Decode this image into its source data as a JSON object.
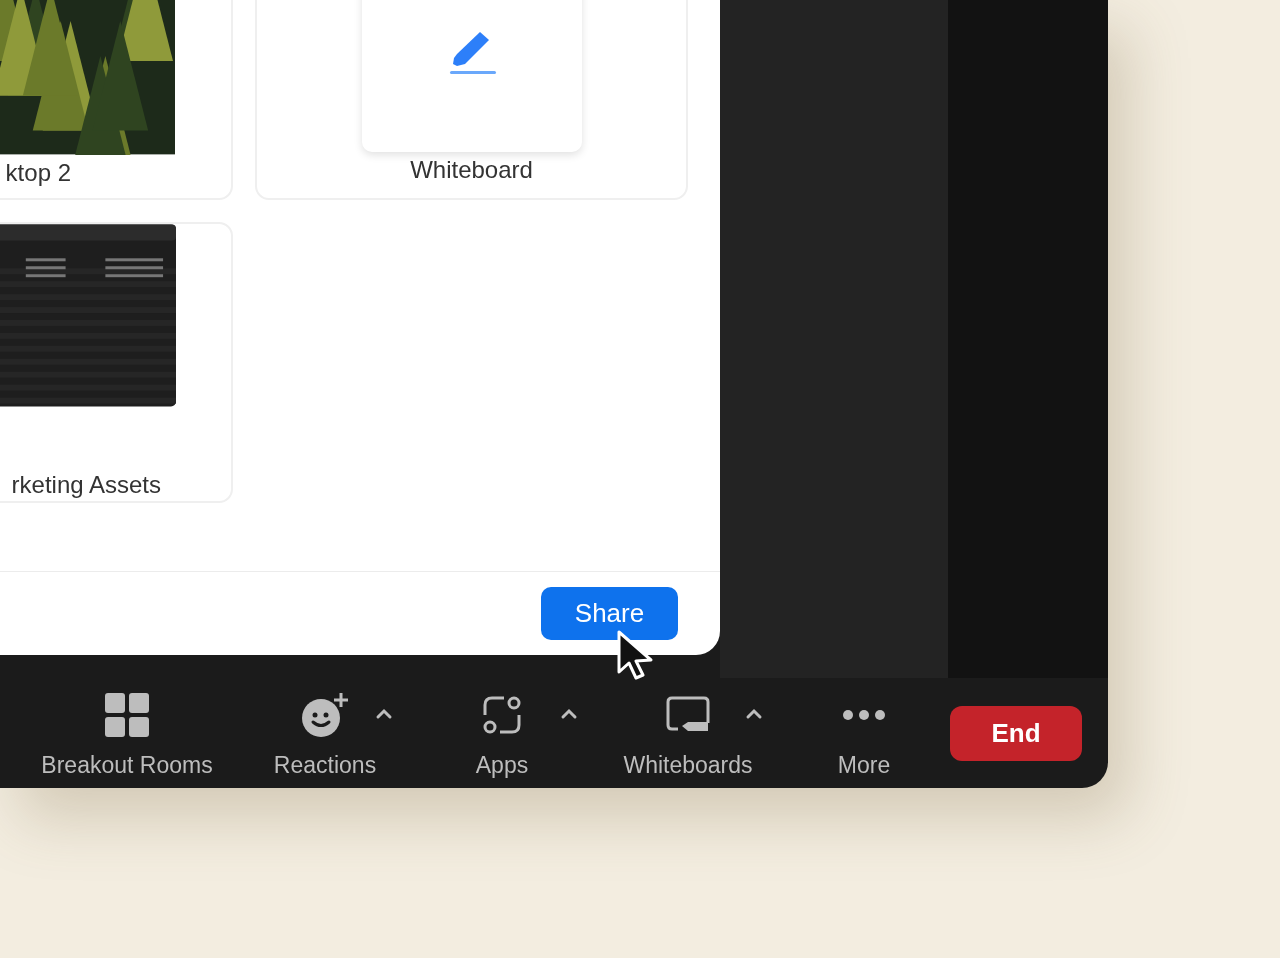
{
  "share_dialog": {
    "items": [
      {
        "label": "ktop 2",
        "kind": "picture",
        "selected": false
      },
      {
        "label": "Whiteboard",
        "kind": "whiteboard",
        "selected": false
      },
      {
        "label": "rketing Assets",
        "kind": "window",
        "selected": false
      }
    ],
    "share_button": "Share"
  },
  "toolbar": {
    "items": [
      {
        "label": "Breakout Rooms",
        "has_menu": false
      },
      {
        "label": "Reactions",
        "has_menu": true
      },
      {
        "label": "Apps",
        "has_menu": true
      },
      {
        "label": "Whiteboards",
        "has_menu": true
      },
      {
        "label": "More",
        "has_menu": false
      }
    ],
    "end_button": "End"
  }
}
